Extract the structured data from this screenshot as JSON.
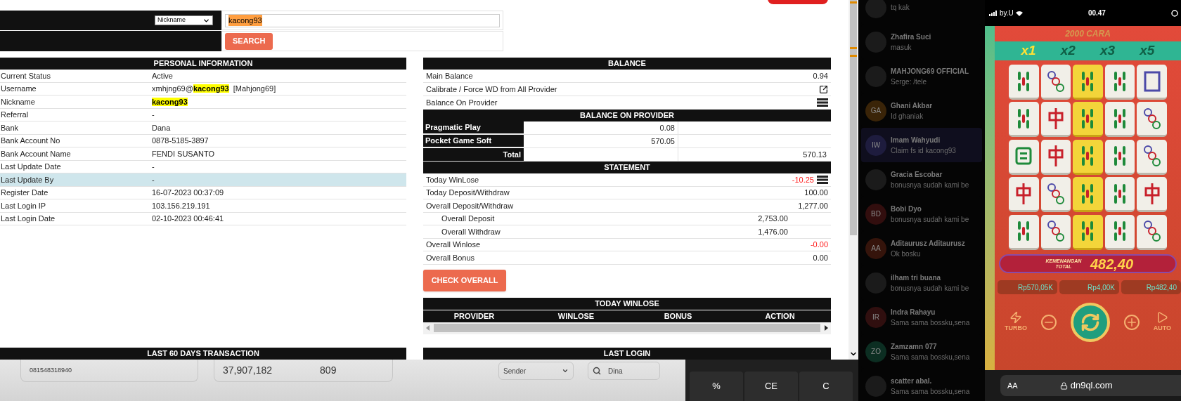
{
  "search": {
    "field_select": "Nickname",
    "value": "kacong93",
    "button": "SEARCH"
  },
  "personal": {
    "title": "PERSONAL INFORMATION",
    "rows": [
      {
        "label": "Current Status",
        "parts": [
          {
            "text": "Active",
            "highlight": false
          }
        ],
        "selected": false
      },
      {
        "label": "Username",
        "parts": [
          {
            "text": "xmhjng69@",
            "highlight": false
          },
          {
            "text": "kacong93",
            "highlight": true
          },
          {
            "text": "  [Mahjong69]",
            "highlight": false
          }
        ],
        "selected": false
      },
      {
        "label": "Nickname",
        "parts": [
          {
            "text": "kacong93",
            "highlight": true
          }
        ],
        "selected": false
      },
      {
        "label": "Referral",
        "parts": [
          {
            "text": "-",
            "highlight": false
          }
        ],
        "selected": false
      },
      {
        "label": "Bank",
        "parts": [
          {
            "text": "Dana",
            "highlight": false
          }
        ],
        "selected": false
      },
      {
        "label": "Bank Account No",
        "parts": [
          {
            "text": "0878-5185-3897",
            "highlight": false
          }
        ],
        "selected": false
      },
      {
        "label": "Bank Account Name",
        "parts": [
          {
            "text": "FENDI SUSANTO",
            "highlight": false
          }
        ],
        "selected": false
      },
      {
        "label": "Last Update Date",
        "parts": [
          {
            "text": "-",
            "highlight": false
          }
        ],
        "selected": false
      },
      {
        "label": "Last Update By",
        "parts": [
          {
            "text": "-",
            "highlight": false
          }
        ],
        "selected": true
      },
      {
        "label": "Register Date",
        "parts": [
          {
            "text": "16-07-2023 00:37:09",
            "highlight": false
          }
        ],
        "selected": false
      },
      {
        "label": "Last Login IP",
        "parts": [
          {
            "text": "103.156.219.191",
            "highlight": false
          }
        ],
        "selected": false
      },
      {
        "label": "Last Login Date",
        "parts": [
          {
            "text": "02-10-2023 00:46:41",
            "highlight": false
          }
        ],
        "selected": false
      }
    ]
  },
  "last_60_days": {
    "title": "LAST 60 DAYS TRANSACTION"
  },
  "balance": {
    "title": "BALANCE",
    "rows": [
      {
        "kind": "value",
        "label": "Main Balance",
        "value": "0.94"
      },
      {
        "kind": "share",
        "label": "Calibrate / Force WD from All Provider"
      },
      {
        "kind": "list",
        "label": "Balance On Provider"
      }
    ]
  },
  "providers": {
    "title": "BALANCE ON PROVIDER",
    "rows": [
      {
        "name": "Pragmatic Play",
        "amount": "0.08"
      },
      {
        "name": "Pocket Game Soft",
        "amount": "570.05"
      }
    ],
    "total_label": "Total",
    "total": "570.13"
  },
  "statement": {
    "title": "STATEMENT",
    "rows": [
      {
        "kind": "main",
        "label": "Today WinLose",
        "value": "-10.25",
        "negative": true,
        "list_action": true
      },
      {
        "kind": "main",
        "label": "Today Deposit/Withdraw",
        "value": "100.00",
        "negative": false,
        "list_action": false
      },
      {
        "kind": "main",
        "label": "Overall Deposit/Withdraw",
        "value": "1,277.00",
        "negative": false,
        "list_action": false
      },
      {
        "kind": "sub",
        "label": "Overall Deposit",
        "value": "2,753.00",
        "negative": false,
        "list_action": false
      },
      {
        "kind": "sub",
        "label": "Overall Withdraw",
        "value": "1,476.00",
        "negative": false,
        "list_action": false
      },
      {
        "kind": "main",
        "label": "Overall Winlose",
        "value": "-0.00",
        "negative": true,
        "list_action": false
      },
      {
        "kind": "main",
        "label": "Overall Bonus",
        "value": "0.00",
        "negative": false,
        "list_action": false
      }
    ]
  },
  "check_button": "CHECK OVERALL",
  "today_winlose": {
    "title": "TODAY WINLOSE",
    "columns": [
      "PROVIDER",
      "WINLOSE",
      "BONUS",
      "ACTION"
    ]
  },
  "last_login": {
    "title": "LAST LOGIN"
  },
  "bottom_app": {
    "account": "081548318940",
    "totals": [
      "37,907,182",
      "809"
    ],
    "sender": "Sender",
    "search": "Dina"
  },
  "calculator": {
    "keys": [
      "%",
      "CE",
      "C"
    ]
  },
  "chats": [
    {
      "message": "tq kak",
      "selected": false
    },
    {
      "name": "Zhafira Suci",
      "message": "masuk",
      "selected": false
    },
    {
      "name": "MAHJONG69 OFFICIAL",
      "message": "Serge: /tele",
      "selected": false
    },
    {
      "name": "Ghani Akbar",
      "message": "Id ghaniak",
      "initials": "GA",
      "color": "#3a2408",
      "selected": false
    },
    {
      "name": "Imam Wahyudi",
      "message": "Claim fs id kacong93",
      "initials": "IW",
      "color": "#1e1c3e",
      "selected": true
    },
    {
      "name": "Gracia Escobar",
      "message": "bonusnya sudah kami be",
      "selected": false
    },
    {
      "name": "Bobi Dyo",
      "message": "bonusnya sudah kami be",
      "initials": "BD",
      "color": "#320e0e",
      "selected": false
    },
    {
      "name": "Aditaurusz Aditaurusz",
      "message": "Ok bosku",
      "initials": "AA",
      "color": "#35140b",
      "selected": false
    },
    {
      "name": "ilham tri buana",
      "message": "bonusnya sudah kami be",
      "selected": false
    },
    {
      "name": "Indra Rahayu",
      "message": "Sama sama bossku,sena",
      "initials": "IR",
      "color": "#300f0f",
      "selected": false
    },
    {
      "name": "Zamzamn 077",
      "message": "Sama sama bossku,sena",
      "initials": "ZO",
      "color": "#0c2e22",
      "selected": false
    },
    {
      "name": "scatter abal.",
      "message": "Sama sama bossku,sena",
      "selected": false
    }
  ],
  "phone": {
    "carrier": "by.U",
    "time": "00.47",
    "text_size_button": "AA",
    "url": "dn9ql.com",
    "game": {
      "banner": "2000 CARA",
      "multipliers": [
        {
          "label": "x1",
          "selected": true
        },
        {
          "label": "x2",
          "selected": false
        },
        {
          "label": "x3",
          "selected": false
        },
        {
          "label": "x5",
          "selected": false
        }
      ],
      "win_label": "KEMENANGAN TOTAL",
      "win_amount": "482,40",
      "balances": [
        "Rp570,05K",
        "Rp4,00K",
        "Rp482,40"
      ],
      "turbo": "TURBO",
      "auto": "AUTO"
    }
  }
}
